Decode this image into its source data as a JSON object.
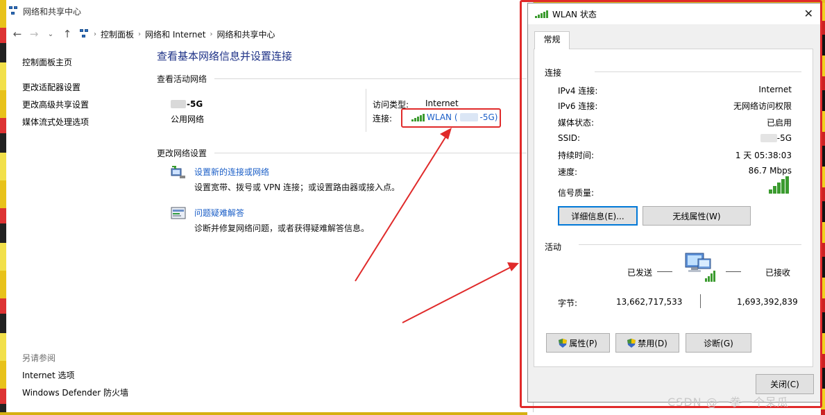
{
  "window": {
    "title": "网络和共享中心",
    "breadcrumb": [
      "控制面板",
      "网络和 Internet",
      "网络和共享中心"
    ]
  },
  "sidebar": {
    "items": [
      "控制面板主页",
      "更改适配器设置",
      "更改高级共享设置",
      "媒体流式处理选项"
    ],
    "see_also_header": "另请参阅",
    "see_also": [
      "Internet 选项",
      "Windows Defender 防火墙"
    ]
  },
  "main": {
    "title": "查看基本网络信息并设置连接",
    "active_header": "查看活动网络",
    "network_name_suffix": "-5G",
    "network_type": "公用网络",
    "access_type_label": "访问类型:",
    "access_type_value": "Internet",
    "connection_label": "连接:",
    "connection_prefix": "WLAN (",
    "connection_suffix": "-5G)",
    "change_header": "更改网络设置",
    "tasks": [
      {
        "link": "设置新的连接或网络",
        "desc": "设置宽带、拨号或 VPN 连接；或设置路由器或接入点。",
        "icon": "network-setup-icon"
      },
      {
        "link": "问题疑难解答",
        "desc": "诊断并修复网络问题，或者获得疑难解答信息。",
        "icon": "troubleshoot-icon"
      }
    ]
  },
  "dialog": {
    "title": "WLAN 状态",
    "tab": "常规",
    "connection_header": "连接",
    "rows": [
      {
        "label": "IPv4 连接:",
        "value": "Internet"
      },
      {
        "label": "IPv6 连接:",
        "value": "无网络访问权限"
      },
      {
        "label": "媒体状态:",
        "value": "已启用"
      },
      {
        "label": "SSID:",
        "value": "-5G"
      },
      {
        "label": "持续时间:",
        "value": "1 天 05:38:03"
      },
      {
        "label": "速度:",
        "value": "86.7 Mbps"
      },
      {
        "label": "信号质量:",
        "value": ""
      }
    ],
    "details_button": "详细信息(E)...",
    "wireless_button": "无线属性(W)",
    "activity_header": "活动",
    "sent_label": "已发送",
    "received_label": "已接收",
    "bytes_label": "字节:",
    "bytes_sent": "13,662,717,533",
    "bytes_received": "1,693,392,839",
    "properties_button": "属性(P)",
    "disable_button": "禁用(D)",
    "diagnose_button": "诊断(G)",
    "close_button": "关闭(C)"
  },
  "watermark": "CSDN @一拳一个呆瓜",
  "colors": {
    "link": "#1a5ec7",
    "title": "#1e3287",
    "annotation_red": "#e02a2a",
    "signal_green": "#3b9b2f"
  }
}
